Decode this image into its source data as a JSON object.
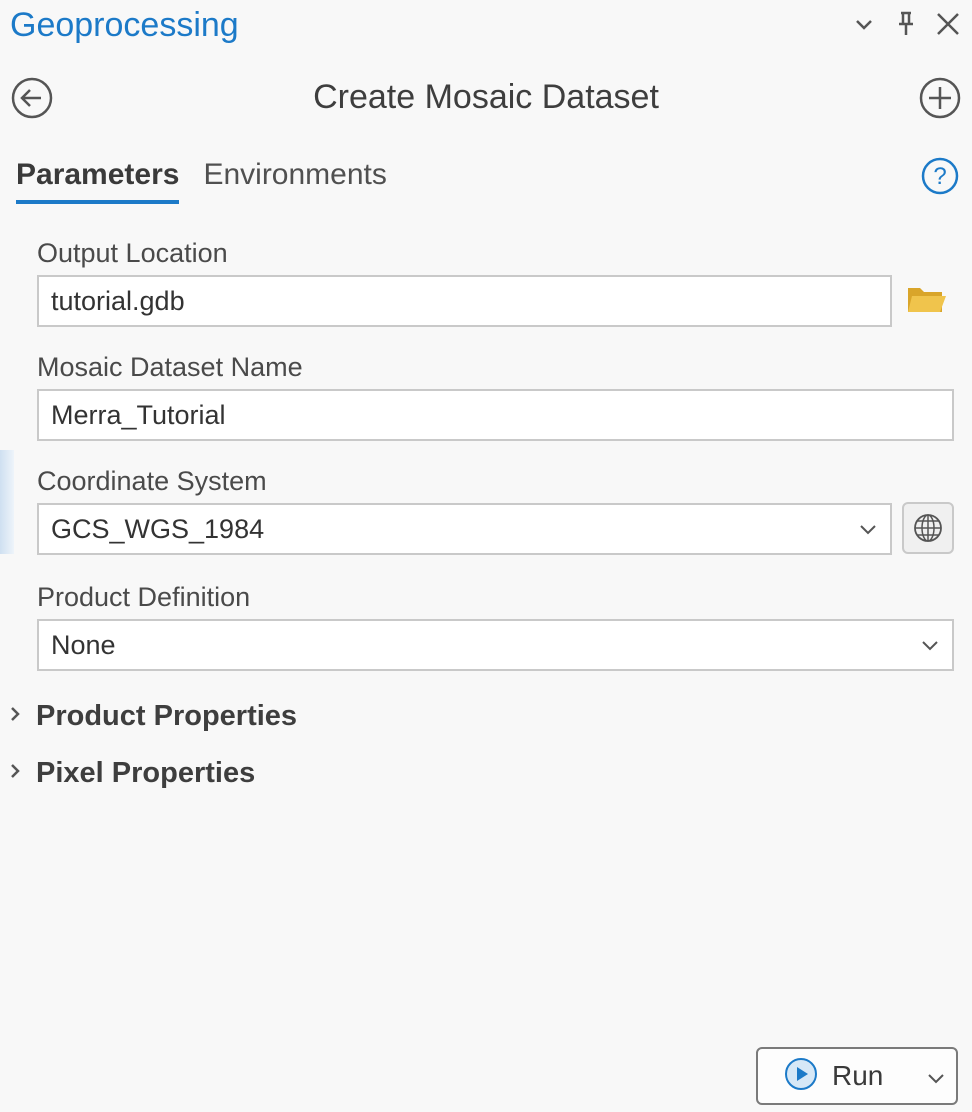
{
  "pane": {
    "title": "Geoprocessing",
    "controls": [
      "chevron-down-icon",
      "pin-icon",
      "close-icon"
    ]
  },
  "tool": {
    "title": "Create Mosaic Dataset",
    "back_icon": "back-arrow-icon",
    "add_icon": "add-icon"
  },
  "tabs": [
    {
      "label": "Parameters",
      "active": true
    },
    {
      "label": "Environments",
      "active": false
    }
  ],
  "params": {
    "output_location": {
      "label": "Output Location",
      "value": "tutorial.gdb"
    },
    "mosaic_name": {
      "label": "Mosaic Dataset Name",
      "value": "Merra_Tutorial"
    },
    "coordinate_system": {
      "label": "Coordinate System",
      "value": "GCS_WGS_1984"
    },
    "product_definition": {
      "label": "Product Definition",
      "value": "None"
    }
  },
  "sections": [
    {
      "label": "Product Properties",
      "expanded": false
    },
    {
      "label": "Pixel Properties",
      "expanded": false
    }
  ],
  "run": {
    "label": "Run"
  },
  "colors": {
    "accent": "#1c7ac8",
    "folder": "#e3b640"
  }
}
